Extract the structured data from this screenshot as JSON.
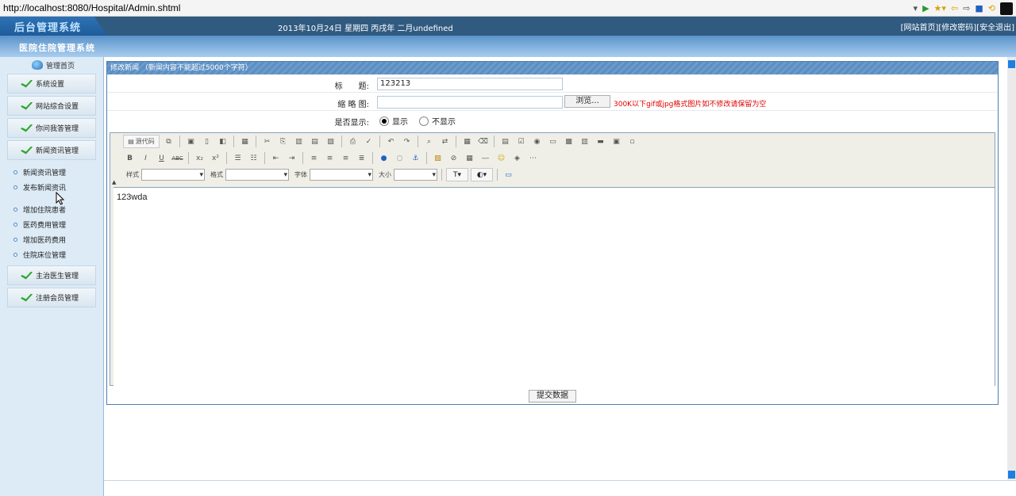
{
  "browser": {
    "url": "http://localhost:8080/Hospital/Admin.shtml"
  },
  "header": {
    "logo": "后台管理系统",
    "date": "2013年10月24日 星期四 丙戌年 二月undefined",
    "links": [
      "[网站首页]",
      "[修改密码]",
      "[安全退出]"
    ],
    "system_title": "医院住院管理系统"
  },
  "sidebar": {
    "home": "管理首页",
    "menus_top": [
      "系统设置",
      "网站综合设置",
      "你问我答管理",
      "新闻资讯管理"
    ],
    "sub_items": [
      "新闻资讯管理",
      "发布新闻资讯",
      "增加住院患者",
      "医药费用管理",
      "增加医药费用",
      "住院床位管理"
    ],
    "menus_bottom": [
      "主治医生管理",
      "注册会员管理"
    ]
  },
  "panel": {
    "title": "修改新闻 （新闻内容不能超过5000个字符）",
    "title_label": "标　　题:",
    "title_value": "123213",
    "thumb_label": "缩 略 图:",
    "browse_label": "浏览...",
    "thumb_hint": "300K以下gif或jpg格式图片如不修改请保留为空",
    "display_label": "是否显示:",
    "show_label": "显示",
    "hide_label": "不显示",
    "show_selected": true
  },
  "editor": {
    "source_label": "源代码",
    "style_label": "样式",
    "format_label": "格式",
    "font_label": "字体",
    "size_label": "大小",
    "content": "123wda"
  },
  "submit_label": "提交数据"
}
